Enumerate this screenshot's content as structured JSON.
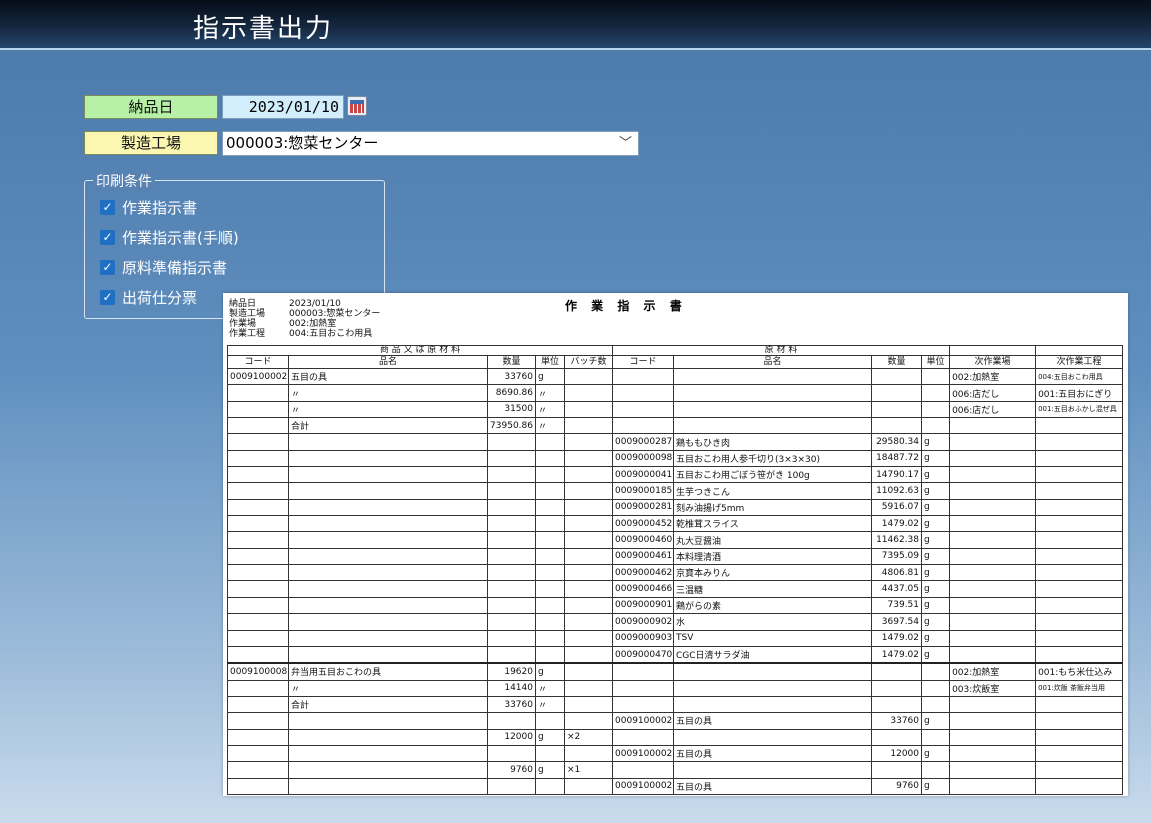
{
  "app": {
    "title": "指示書出力"
  },
  "form": {
    "delivery_date_label": "納品日",
    "delivery_date_value": "2023/01/10",
    "factory_label": "製造工場",
    "factory_value": "000003:惣菜センター",
    "print_conditions_label": "印刷条件",
    "options": [
      {
        "label": "作業指示書",
        "checked": true
      },
      {
        "label": "作業指示書(手順)",
        "checked": true
      },
      {
        "label": "原料準備指示書",
        "checked": true
      },
      {
        "label": "出荷仕分票",
        "checked": true
      }
    ]
  },
  "colors": {
    "label_green": "#b7f0a6",
    "label_yellow": "#fbf7b0",
    "checkbox": "#1f6fc5"
  },
  "doc": {
    "title": "作 業 指 示 書",
    "meta": [
      {
        "label": "納品日",
        "value": "2023/01/10"
      },
      {
        "label": "製造工場",
        "value": "000003:惣菜センター"
      },
      {
        "label": "作業場",
        "value": "002:加熱室"
      },
      {
        "label": "作業工程",
        "value": "004:五目おこわ用具"
      }
    ],
    "group_headers": {
      "left": "商 品 又 は 原 材 料",
      "right": "原 材 料"
    },
    "columns": [
      "コード",
      "品名",
      "数量",
      "単位",
      "バッチ数",
      "コード",
      "品名",
      "数量",
      "単位",
      "次作業場",
      "次作業工程"
    ],
    "rows": [
      [
        "0009100002",
        "五目の具",
        "33760",
        "g",
        "",
        "",
        "",
        "",
        "",
        "002:加熱室",
        "004:五目おこわ用具"
      ],
      [
        "",
        "〃",
        "8690.86",
        "〃",
        "",
        "",
        "",
        "",
        "",
        "006:店だし",
        "001:五目おにぎり"
      ],
      [
        "",
        "〃",
        "31500",
        "〃",
        "",
        "",
        "",
        "",
        "",
        "006:店だし",
        "001:五目おふかし混ぜ具"
      ],
      [
        "",
        "合計",
        "73950.86",
        "〃",
        "",
        "",
        "",
        "",
        "",
        "",
        ""
      ],
      [
        "",
        "",
        "",
        "",
        "",
        "0009000287",
        "鶏ももひき肉",
        "29580.34",
        "g",
        "",
        ""
      ],
      [
        "",
        "",
        "",
        "",
        "",
        "0009000098",
        "五目おこわ用人参千切り(3×3×30)",
        "18487.72",
        "g",
        "",
        ""
      ],
      [
        "",
        "",
        "",
        "",
        "",
        "0009000041",
        "五目おこわ用ごぼう笹がき 100g",
        "14790.17",
        "g",
        "",
        ""
      ],
      [
        "",
        "",
        "",
        "",
        "",
        "0009000185",
        "生芋つきこん",
        "11092.63",
        "g",
        "",
        ""
      ],
      [
        "",
        "",
        "",
        "",
        "",
        "0009000281",
        "刻み油揚げ5mm",
        "5916.07",
        "g",
        "",
        ""
      ],
      [
        "",
        "",
        "",
        "",
        "",
        "0009000452",
        "乾椎茸スライス",
        "1479.02",
        "g",
        "",
        ""
      ],
      [
        "",
        "",
        "",
        "",
        "",
        "0009000460",
        "丸大豆醤油",
        "11462.38",
        "g",
        "",
        ""
      ],
      [
        "",
        "",
        "",
        "",
        "",
        "0009000461",
        "本料理清酒",
        "7395.09",
        "g",
        "",
        ""
      ],
      [
        "",
        "",
        "",
        "",
        "",
        "0009000462",
        "京寶本みりん",
        "4806.81",
        "g",
        "",
        ""
      ],
      [
        "",
        "",
        "",
        "",
        "",
        "0009000466",
        "三温糖",
        "4437.05",
        "g",
        "",
        ""
      ],
      [
        "",
        "",
        "",
        "",
        "",
        "0009000901",
        "鶏がらの素",
        "739.51",
        "g",
        "",
        ""
      ],
      [
        "",
        "",
        "",
        "",
        "",
        "0009000902",
        "水",
        "3697.54",
        "g",
        "",
        ""
      ],
      [
        "",
        "",
        "",
        "",
        "",
        "0009000903",
        "TSV",
        "1479.02",
        "g",
        "",
        ""
      ],
      [
        "",
        "",
        "",
        "",
        "",
        "0009000470",
        "CGC日清サラダ油",
        "1479.02",
        "g",
        "",
        ""
      ],
      [
        "0009100008",
        "弁当用五目おこわの具",
        "19620",
        "g",
        "",
        "",
        "",
        "",
        "",
        "002:加熱室",
        "001:もち米仕込み"
      ],
      [
        "",
        "〃",
        "14140",
        "〃",
        "",
        "",
        "",
        "",
        "",
        "003:炊飯室",
        "001:炊飯 茶飯弁当用"
      ],
      [
        "",
        "合計",
        "33760",
        "〃",
        "",
        "",
        "",
        "",
        "",
        "",
        ""
      ],
      [
        "",
        "",
        "",
        "",
        "",
        "0009100002",
        "五目の具",
        "33760",
        "g",
        "",
        ""
      ],
      [
        "",
        "",
        "12000",
        "g",
        "×2",
        "",
        "",
        "",
        "",
        "",
        ""
      ],
      [
        "",
        "",
        "",
        "",
        "",
        "0009100002",
        "五目の具",
        "12000",
        "g",
        "",
        ""
      ],
      [
        "",
        "",
        "9760",
        "g",
        "×1",
        "",
        "",
        "",
        "",
        "",
        ""
      ],
      [
        "",
        "",
        "",
        "",
        "",
        "0009100002",
        "五目の具",
        "9760",
        "g",
        "",
        ""
      ]
    ]
  }
}
